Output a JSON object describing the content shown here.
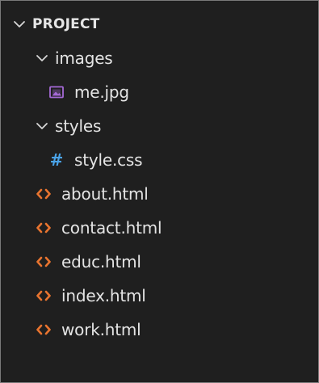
{
  "explorer": {
    "project_label": "PROJECT",
    "items": [
      {
        "label": "images",
        "kind": "folder",
        "expanded": true
      },
      {
        "label": "me.jpg",
        "kind": "image-file"
      },
      {
        "label": "styles",
        "kind": "folder",
        "expanded": true
      },
      {
        "label": "style.css",
        "kind": "css-file"
      },
      {
        "label": "about.html",
        "kind": "html-file"
      },
      {
        "label": "contact.html",
        "kind": "html-file"
      },
      {
        "label": "educ.html",
        "kind": "html-file"
      },
      {
        "label": "index.html",
        "kind": "html-file"
      },
      {
        "label": "work.html",
        "kind": "html-file"
      }
    ]
  },
  "icons": {
    "chevron": "chevron-down-icon",
    "image": "image-file-icon",
    "css": "css-hash-icon",
    "html": "html-code-icon"
  },
  "colors": {
    "background": "#1f1f1f",
    "text": "#e4e4e4",
    "html_icon": "#e8742f",
    "css_icon": "#4aa3e8",
    "image_icon": "#a56ad6"
  }
}
